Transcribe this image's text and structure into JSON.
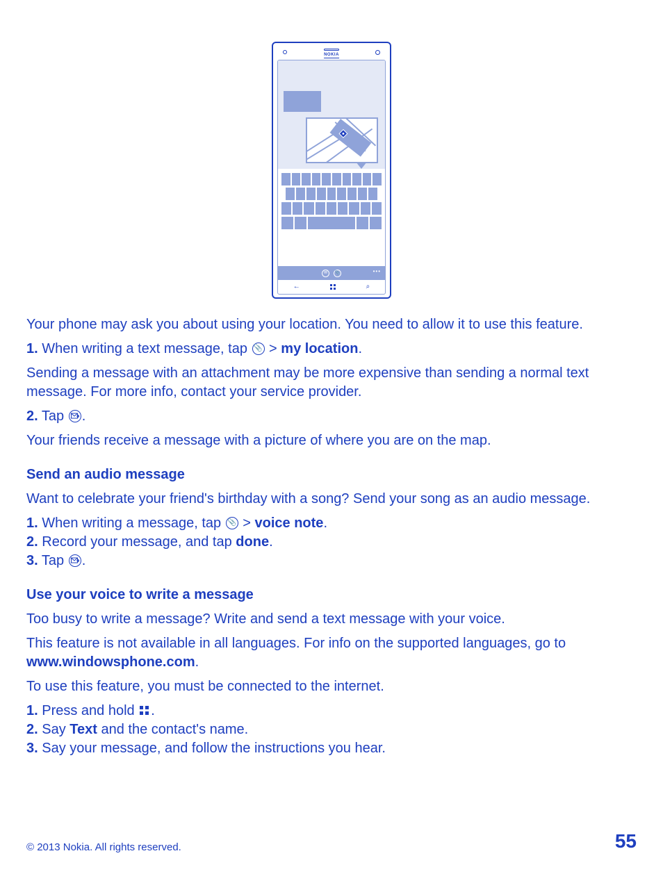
{
  "illustration": {
    "brand": "NOKIA"
  },
  "intro": "Your phone may ask you about using your location. You need to allow it to use this feature.",
  "loc_step1_a": "When writing a text message, tap ",
  "loc_step1_b": " > ",
  "loc_step1_c": "my location",
  "loc_step1_d": ".",
  "loc_note": "Sending a message with an attachment may be more expensive than sending a normal text message. For more info, contact your service provider.",
  "loc_step2_a": "Tap ",
  "loc_step2_b": ".",
  "loc_result": "Your friends receive a message with a picture of where you are on the map.",
  "audio_heading": "Send an audio message",
  "audio_intro": "Want to celebrate your friend's birthday with a song? Send your song as an audio message.",
  "audio_step1_a": "When writing a message, tap ",
  "audio_step1_b": " > ",
  "audio_step1_c": "voice note",
  "audio_step1_d": ".",
  "audio_step2_a": "Record your message, and tap ",
  "audio_step2_b": "done",
  "audio_step2_c": ".",
  "audio_step3_a": "Tap ",
  "audio_step3_b": ".",
  "voice_heading": "Use your voice to write a message",
  "voice_intro": "Too busy to write a message? Write and send a text message with your voice.",
  "voice_note_a": "This feature is not available in all languages. For info on the supported languages, go to ",
  "voice_note_b": "www.windowsphone.com",
  "voice_note_c": ".",
  "voice_req": "To use this feature, you must be connected to the internet.",
  "voice_step1_a": "Press and hold ",
  "voice_step1_b": ".",
  "voice_step2_a": "Say ",
  "voice_step2_b": "Text",
  "voice_step2_c": " and the contact's name.",
  "voice_step3": "Say your message, and follow the instructions you hear.",
  "num1": "1.",
  "num2": "2.",
  "num3": "3.",
  "footer_copy": "© 2013 Nokia. All rights reserved.",
  "footer_page": "55"
}
